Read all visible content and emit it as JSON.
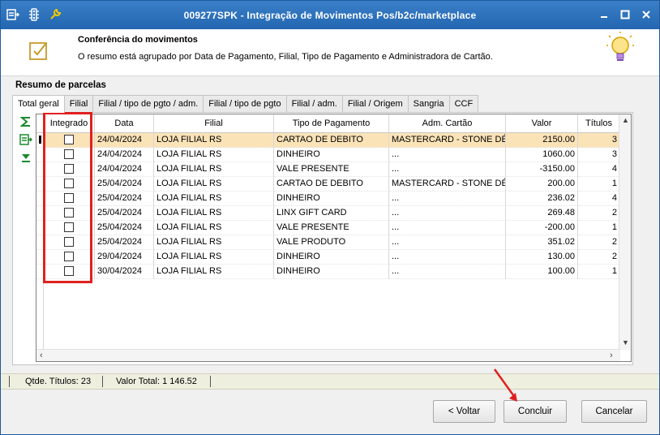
{
  "window": {
    "title": "009277SPK - Integração de Movimentos Pos/b2c/marketplace",
    "controls": [
      "minimize",
      "maximize",
      "close"
    ]
  },
  "header": {
    "title": "Conferência do movimentos",
    "subtitle": "O resumo está agrupado por Data de Pagamento, Filial, Tipo de Pagamento e Administradora de Cartão."
  },
  "section_label": "Resumo de parcelas",
  "tabs": [
    {
      "label": "Total geral",
      "active": true
    },
    {
      "label": "Filial"
    },
    {
      "label": "Filial / tipo de pgto / adm."
    },
    {
      "label": "Filial / tipo de pgto"
    },
    {
      "label": "Filial / adm."
    },
    {
      "label": "Filial / Origem"
    },
    {
      "label": "Sangria"
    },
    {
      "label": "CCF"
    }
  ],
  "grid": {
    "columns": [
      "Integrado",
      "Data",
      "Filial",
      "Tipo de Pagamento",
      "Adm. Cartão",
      "Valor",
      "Títulos"
    ],
    "rows": [
      {
        "integrado": false,
        "data": "24/04/2024",
        "filial": "LOJA FILIAL RS",
        "tipo": "CARTAO DE DEBITO",
        "adm": "MASTERCARD -  STONE DÉBI",
        "valor": "2150.00",
        "titulos": "3",
        "selected": true
      },
      {
        "integrado": false,
        "data": "24/04/2024",
        "filial": "LOJA FILIAL RS",
        "tipo": "DINHEIRO",
        "adm": "...",
        "valor": "1060.00",
        "titulos": "3"
      },
      {
        "integrado": false,
        "data": "24/04/2024",
        "filial": "LOJA FILIAL RS",
        "tipo": "VALE PRESENTE",
        "adm": "...",
        "valor": "-3150.00",
        "titulos": "4"
      },
      {
        "integrado": false,
        "data": "25/04/2024",
        "filial": "LOJA FILIAL RS",
        "tipo": "CARTAO DE DEBITO",
        "adm": "MASTERCARD -  STONE DÉBI",
        "valor": "200.00",
        "titulos": "1"
      },
      {
        "integrado": false,
        "data": "25/04/2024",
        "filial": "LOJA FILIAL RS",
        "tipo": "DINHEIRO",
        "adm": "...",
        "valor": "236.02",
        "titulos": "4"
      },
      {
        "integrado": false,
        "data": "25/04/2024",
        "filial": "LOJA FILIAL RS",
        "tipo": "LINX GIFT CARD",
        "adm": "...",
        "valor": "269.48",
        "titulos": "2"
      },
      {
        "integrado": false,
        "data": "25/04/2024",
        "filial": "LOJA FILIAL RS",
        "tipo": "VALE PRESENTE",
        "adm": "...",
        "valor": "-200.00",
        "titulos": "1"
      },
      {
        "integrado": false,
        "data": "25/04/2024",
        "filial": "LOJA FILIAL RS",
        "tipo": "VALE PRODUTO",
        "adm": "...",
        "valor": "351.02",
        "titulos": "2"
      },
      {
        "integrado": false,
        "data": "29/04/2024",
        "filial": "LOJA FILIAL RS",
        "tipo": "DINHEIRO",
        "adm": "...",
        "valor": "130.00",
        "titulos": "2"
      },
      {
        "integrado": false,
        "data": "30/04/2024",
        "filial": "LOJA FILIAL RS",
        "tipo": "DINHEIRO",
        "adm": "...",
        "valor": "100.00",
        "titulos": "1"
      }
    ]
  },
  "status": {
    "qtde_titulos": "Qtde. Títulos:  23",
    "valor_total": "Valor Total:  1 146.52"
  },
  "buttons": {
    "voltar": "< Voltar",
    "concluir": "Concluir",
    "cancelar": "Cancelar"
  },
  "colors": {
    "titlebar": "#2366b1",
    "selected_row": "#fbe3b8",
    "highlight": "#e02020"
  }
}
